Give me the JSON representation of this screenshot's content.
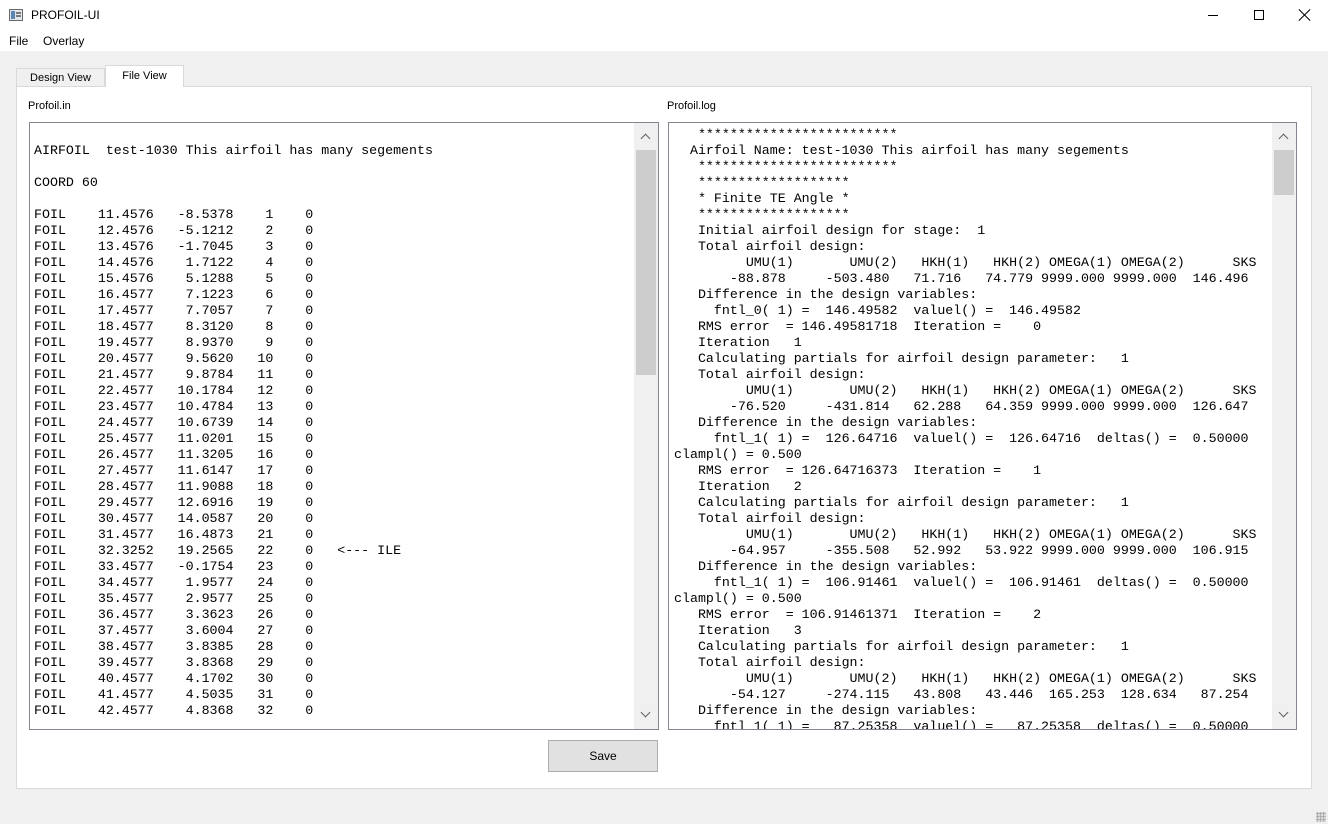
{
  "window": {
    "title": "PROFOIL-UI",
    "icon": "app-window-icon",
    "controls": [
      "minimize-icon",
      "maximize-icon",
      "close-icon"
    ]
  },
  "menu": [
    "File",
    "Overlay"
  ],
  "tabs": [
    {
      "label": "Design View",
      "active": false
    },
    {
      "label": "File View",
      "active": true
    }
  ],
  "left_pane": {
    "label": "Profoil.in",
    "text": "\nAIRFOIL  test-1030 This airfoil has many segements\n\nCOORD 60\n\nFOIL    11.4576   -8.5378    1    0\nFOIL    12.4576   -5.1212    2    0\nFOIL    13.4576   -1.7045    3    0\nFOIL    14.4576    1.7122    4    0\nFOIL    15.4576    5.1288    5    0\nFOIL    16.4577    7.1223    6    0\nFOIL    17.4577    7.7057    7    0\nFOIL    18.4577    8.3120    8    0\nFOIL    19.4577    8.9370    9    0\nFOIL    20.4577    9.5620   10    0\nFOIL    21.4577    9.8784   11    0\nFOIL    22.4577   10.1784   12    0\nFOIL    23.4577   10.4784   13    0\nFOIL    24.4577   10.6739   14    0\nFOIL    25.4577   11.0201   15    0\nFOIL    26.4577   11.3205   16    0\nFOIL    27.4577   11.6147   17    0\nFOIL    28.4577   11.9088   18    0\nFOIL    29.4577   12.6916   19    0\nFOIL    30.4577   14.0587   20    0\nFOIL    31.4577   16.4873   21    0\nFOIL    32.3252   19.2565   22    0   <--- ILE\nFOIL    33.4577   -0.1754   23    0\nFOIL    34.4577    1.9577   24    0\nFOIL    35.4577    2.9577   25    0\nFOIL    36.4577    3.3623   26    0\nFOIL    37.4577    3.6004   27    0\nFOIL    38.4577    3.8385   28    0\nFOIL    39.4577    3.8368   29    0\nFOIL    40.4577    4.1702   30    0\nFOIL    41.4577    4.5035   31    0\nFOIL    42.4577    4.8368   32    0"
  },
  "right_pane": {
    "label": "Profoil.log",
    "text": "   *************************\n  Airfoil Name: test-1030 This airfoil has many segements\n   *************************\n   *******************\n   * Finite TE Angle *\n   *******************\n   Initial airfoil design for stage:  1\n   Total airfoil design:\n         UMU(1)       UMU(2)   HKH(1)   HKH(2) OMEGA(1) OMEGA(2)      SKS\n       -88.878     -503.480   71.716   74.779 9999.000 9999.000  146.496\n   Difference in the design variables:\n     fntl_0( 1) =  146.49582  valuel() =  146.49582\n   RMS error  = 146.49581718  Iteration =    0\n   Iteration   1\n   Calculating partials for airfoil design parameter:   1\n   Total airfoil design:\n         UMU(1)       UMU(2)   HKH(1)   HKH(2) OMEGA(1) OMEGA(2)      SKS\n       -76.520     -431.814   62.288   64.359 9999.000 9999.000  126.647\n   Difference in the design variables:\n     fntl_1( 1) =  126.64716  valuel() =  126.64716  deltas() =  0.50000\nclampl() = 0.500\n   RMS error  = 126.64716373  Iteration =    1\n   Iteration   2\n   Calculating partials for airfoil design parameter:   1\n   Total airfoil design:\n         UMU(1)       UMU(2)   HKH(1)   HKH(2) OMEGA(1) OMEGA(2)      SKS\n       -64.957     -355.508   52.992   53.922 9999.000 9999.000  106.915\n   Difference in the design variables:\n     fntl_1( 1) =  106.91461  valuel() =  106.91461  deltas() =  0.50000\nclampl() = 0.500\n   RMS error  = 106.91461371  Iteration =    2\n   Iteration   3\n   Calculating partials for airfoil design parameter:   1\n   Total airfoil design:\n         UMU(1)       UMU(2)   HKH(1)   HKH(2) OMEGA(1) OMEGA(2)      SKS\n       -54.127     -274.115   43.808   43.446  165.253  128.634   87.254\n   Difference in the design variables:\n     fntl_1( 1) =   87.25358  valuel() =   87.25358  deltas() =  0.50000"
  },
  "buttons": {
    "save": "Save"
  },
  "colors": {
    "panel_bg": "#ffffff",
    "window_bg": "#f0f0f0",
    "border": "#828790",
    "scroll_thumb": "#cdcdcd"
  }
}
